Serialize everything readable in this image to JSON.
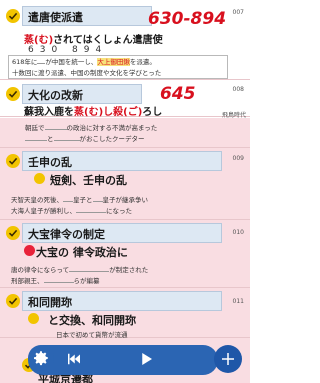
{
  "card1": {
    "title": "遣唐使派遣",
    "number": "007",
    "red_num": "630-894",
    "mnemo_pre": "",
    "mnemo_red": "蒸(む)",
    "mnemo_post": "されてはくしょん遣唐使",
    "digits": "630 894",
    "desc_line1_a": "618年に",
    "desc_line1_b": "が中国を統一し、",
    "desc_line1_c": "大上御田鍬",
    "desc_line1_d": "を派遣。",
    "desc_line2": "十数回に渡り派遣、中国の制度や文化を学びとった"
  },
  "card2": {
    "title": "大化の改新",
    "number": "008",
    "red_num": "645",
    "mnemo_pre": "蘇我入鹿を",
    "mnemo_red": "蒸(む)し殺(ご)",
    "mnemo_post": "ろし",
    "era_label": "飛鳥時代",
    "desc_line1_a": "朝廷で",
    "desc_line1_b": "の政治に対する不満が高まった",
    "desc_line2_a": "と",
    "desc_line2_b": "がおこしたクーデター"
  },
  "card3": {
    "title": "壬申の乱",
    "number": "009",
    "subtitle": "短剣、壬申の乱",
    "desc_line1_a": "天智天皇の死後、",
    "desc_line1_b": "皇子",
    "desc_line1_c": "と",
    "desc_line1_d": "皇子",
    "desc_line1_e": "が継承争い",
    "desc_line2_a": "大海人皇子が勝利し、",
    "desc_line2_b": "になった"
  },
  "card4": {
    "title": "大宝律令の制定",
    "number": "010",
    "subtitle": "大宝の 律令政治に",
    "desc_line1_a": "唐の律令にならって",
    "desc_line1_b": "が制定された",
    "desc_line2_a": "刑部親王、",
    "desc_line2_b": "らが編纂"
  },
  "card5": {
    "title": "和同開珎",
    "number": "011",
    "subtitle": "と交換、和同開珎",
    "desc_line1": "日本で初めて貨幣が流通"
  },
  "card6": {
    "title": "平城京遷都"
  },
  "controls": {
    "settings": "settings",
    "rewind": "rewind",
    "play": "play",
    "add": "add"
  }
}
